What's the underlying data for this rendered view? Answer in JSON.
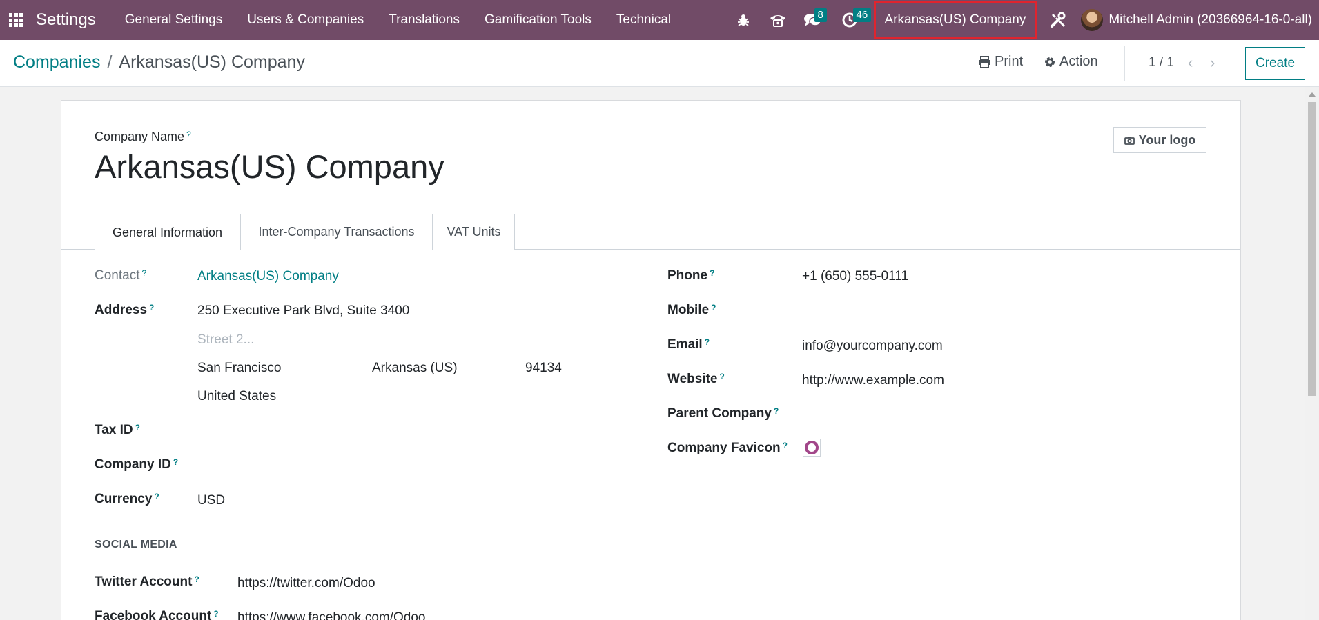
{
  "navbar": {
    "app_name": "Settings",
    "menu": [
      "General Settings",
      "Users & Companies",
      "Translations",
      "Gamification Tools",
      "Technical"
    ],
    "messages_badge": "8",
    "activities_badge": "46",
    "company_switcher": "Arkansas(US) Company",
    "user_name": "Mitchell Admin (20366964-16-0-all)",
    "accent_color": "#714b67",
    "icons": [
      "apps-grid-icon",
      "bug-icon",
      "phone-icon",
      "chat-icon",
      "clock-icon",
      "tools-icon"
    ]
  },
  "control_panel": {
    "breadcrumb_parent": "Companies",
    "breadcrumb_separator": "/",
    "breadcrumb_current": "Arkansas(US) Company",
    "print_label": "Print",
    "action_label": "Action",
    "pager": "1 / 1",
    "create_label": "Create"
  },
  "form": {
    "company_name_label": "Company Name",
    "company_name": "Arkansas(US) Company",
    "logo_button": "Your logo",
    "tabs": [
      "General Information",
      "Inter-Company Transactions",
      "VAT Units"
    ],
    "left": {
      "contact_label": "Contact",
      "contact_value": "Arkansas(US) Company",
      "address_label": "Address",
      "street": "250 Executive Park Blvd, Suite 3400",
      "street2_placeholder": "Street 2...",
      "city": "San Francisco",
      "state": "Arkansas (US)",
      "zip": "94134",
      "country": "United States",
      "tax_id_label": "Tax ID",
      "company_id_label": "Company ID",
      "currency_label": "Currency",
      "currency_value": "USD"
    },
    "right": {
      "phone_label": "Phone",
      "phone_value": "+1 (650) 555-0111",
      "mobile_label": "Mobile",
      "email_label": "Email",
      "email_value": "info@yourcompany.com",
      "website_label": "Website",
      "website_value": "http://www.example.com",
      "parent_company_label": "Parent Company",
      "favicon_label": "Company Favicon"
    },
    "social": {
      "title": "SOCIAL MEDIA",
      "twitter_label": "Twitter Account",
      "twitter_value": "https://twitter.com/Odoo",
      "facebook_label": "Facebook Account",
      "facebook_value": "https://www.facebook.com/Odoo"
    },
    "tooltip_mark": "?"
  }
}
